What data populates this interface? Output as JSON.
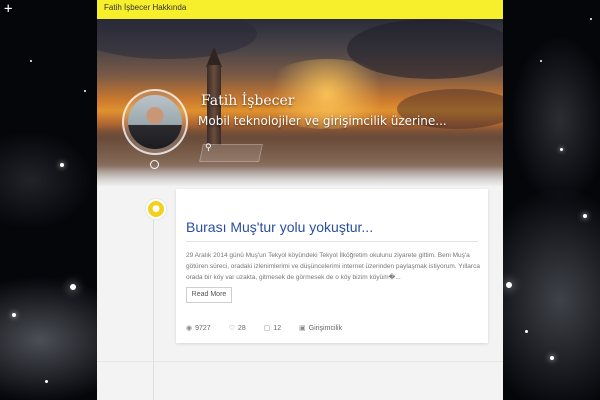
{
  "topbar": {
    "nav_link": "Fatih İşbecer Hakkında"
  },
  "header": {
    "site_title": "Fatih İşbecer",
    "tagline": "Mobil teknolojiler ve girişimcilik üzerine..."
  },
  "icons": {
    "plus": "plus-icon",
    "search": "search-icon",
    "pin": "pin-icon",
    "views": "eye-icon",
    "likes": "heart-icon",
    "comments": "comment-icon",
    "category": "folder-icon"
  },
  "colors": {
    "topbar": "#f7ef2b",
    "accent_yellow": "#f4d01c",
    "title_blue": "#2a4fa0"
  },
  "post": {
    "title": "Burası Muş'tur yolu yokuştur...",
    "excerpt": "29 Aralık 2014 günü Muş'un Tekyol köyündeki Tekyol İlköğretim okulunu ziyarete gittim. Beni Muş'a götüren süreci, oradaki izlenimlerimi ve düşüncelerimi internet üzerinden paylaşmak istiyorum. Yıllarca orada bir köy var uzakta, gitmesek de görmesek de o köy bizim köyüm�...",
    "read_more": "Read More",
    "views": "9727",
    "likes": "28",
    "comments": "12",
    "category": "Girişimcilik"
  }
}
